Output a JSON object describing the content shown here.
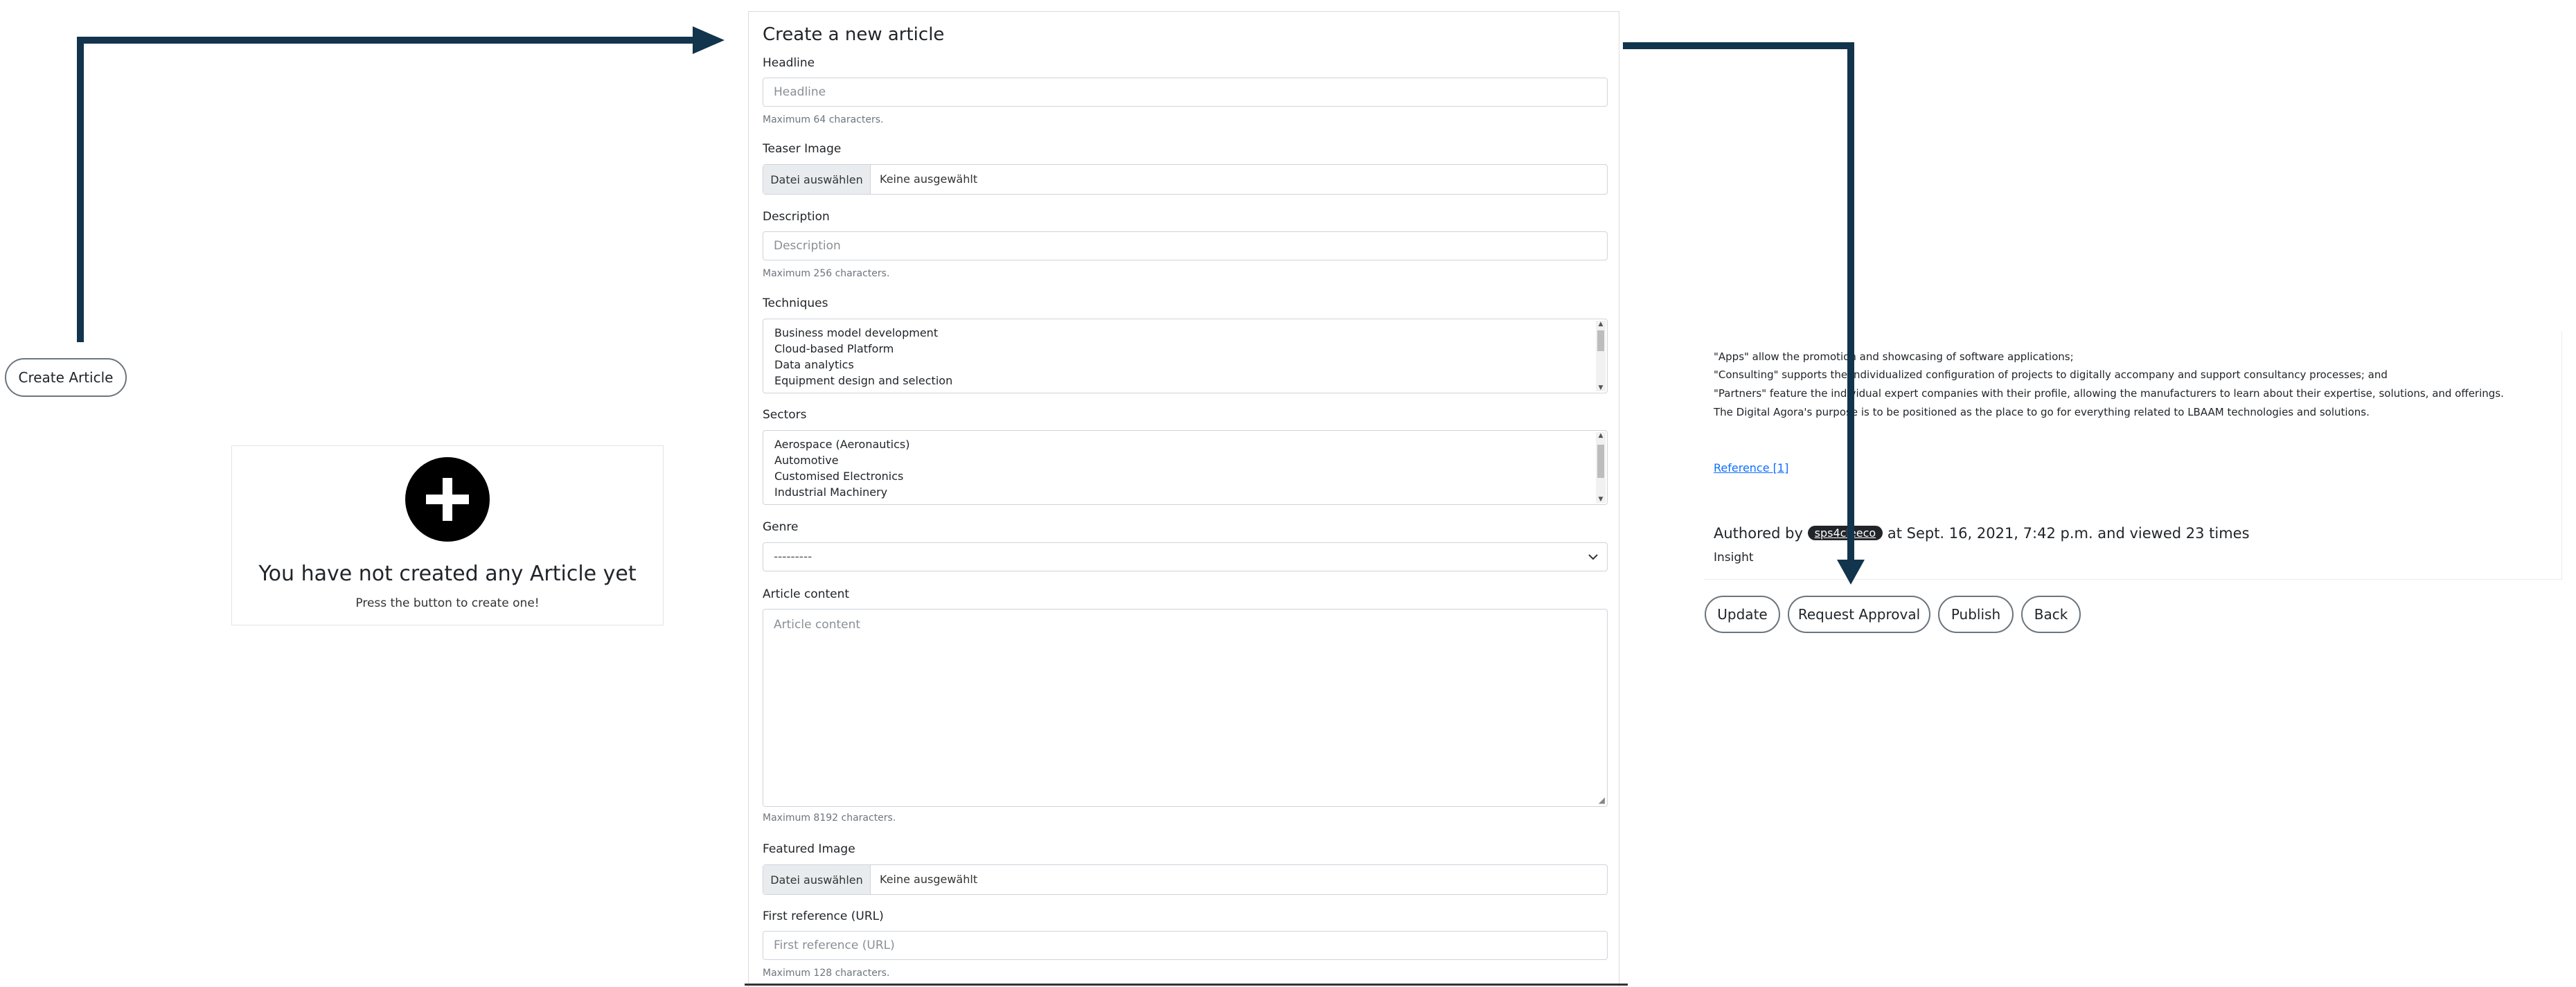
{
  "create_button": {
    "label": "Create Article"
  },
  "empty_state": {
    "title": "You have not created any Article yet",
    "subtitle": "Press the button to create one!"
  },
  "form": {
    "title": "Create a new article",
    "headline": {
      "label": "Headline",
      "placeholder": "Headline",
      "help": "Maximum 64 characters."
    },
    "teaser_image": {
      "label": "Teaser Image",
      "button": "Datei auswählen",
      "file_status": "Keine ausgewählt"
    },
    "description": {
      "label": "Description",
      "placeholder": "Description",
      "help": "Maximum 256 characters."
    },
    "techniques": {
      "label": "Techniques",
      "options": [
        "Business model development",
        "Cloud-based Platform",
        "Data analytics",
        "Equipment design and selection"
      ]
    },
    "sectors": {
      "label": "Sectors",
      "options": [
        "Aerospace (Aeronautics)",
        "Automotive",
        "Customised Electronics",
        "Industrial Machinery"
      ]
    },
    "genre": {
      "label": "Genre",
      "selected": "---------"
    },
    "article_content": {
      "label": "Article content",
      "placeholder": "Article content",
      "help": "Maximum 8192 characters."
    },
    "featured_image": {
      "label": "Featured Image",
      "button": "Datei auswählen",
      "file_status": "Keine ausgewählt"
    },
    "first_reference": {
      "label": "First reference (URL)",
      "placeholder": "First reference (URL)",
      "help": "Maximum 128 characters."
    }
  },
  "article": {
    "lines": [
      "\"Apps\" allow the promotion and showcasing of software applications;",
      "\"Consulting\" supports the individualized configuration of projects to digitally accompany and support consultancy processes; and",
      "\"Partners\" feature the individual expert companies with their profile, allowing the manufacturers to learn about their expertise, solutions, and offerings.",
      "The Digital Agora's purpose is to be positioned as the place to go for everything related to LBAAM technologies and solutions."
    ],
    "reference_link": "Reference [1]",
    "authored_prefix": "Authored by",
    "author": "sps4cleeco",
    "authored_suffix": "at Sept. 16, 2021, 7:42 p.m. and viewed 23 times",
    "genre": "Insight"
  },
  "actions": {
    "update": "Update",
    "request_approval": "Request Approval",
    "publish": "Publish",
    "back": "Back"
  },
  "colors": {
    "arrow": "#12344d",
    "link": "#0d6efd",
    "badge": "#212529"
  },
  "icons": [
    "plus-circle-icon",
    "chevron-down-icon",
    "arrow-right-icon",
    "arrow-down-icon"
  ]
}
